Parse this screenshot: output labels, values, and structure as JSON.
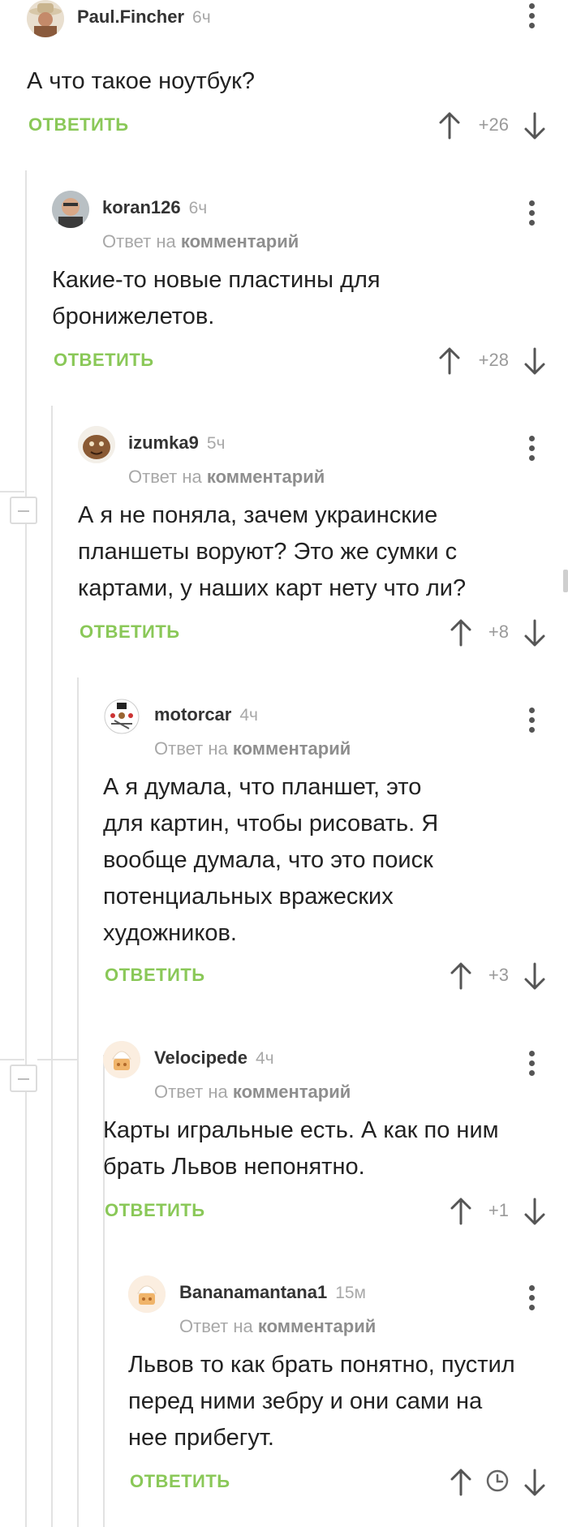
{
  "colors": {
    "accent": "#8ac858",
    "muted": "#a8a8a8",
    "text": "#222222"
  },
  "comments": [
    {
      "username": "Paul.Fincher",
      "time": "6ч",
      "reply_prefix": "",
      "reply_target": "",
      "text": "А что такое ноутбук?",
      "reply_label": "ОТВЕТИТЬ",
      "score": "+26"
    },
    {
      "username": "koran126",
      "time": "6ч",
      "reply_prefix": "Ответ на",
      "reply_target": "комментарий",
      "text": "Какие-то новые пластины для бронижелетов.",
      "reply_label": "ОТВЕТИТЬ",
      "score": "+28"
    },
    {
      "username": "izumka9",
      "time": "5ч",
      "reply_prefix": "Ответ на",
      "reply_target": "комментарий",
      "text": "А я не поняла, зачем украинские планшеты воруют? Это же сумки с картами, у наших карт нету что ли?",
      "reply_label": "ОТВЕТИТЬ",
      "score": "+8"
    },
    {
      "username": "motorcar",
      "time": "4ч",
      "reply_prefix": "Ответ на",
      "reply_target": "комментарий",
      "text": "А я думала, что планшет, это для картин, чтобы рисовать. Я вообще думала, что это поиск потенциальных вражеских художников.",
      "reply_label": "ОТВЕТИТЬ",
      "score": "+3"
    },
    {
      "username": "Velocipede",
      "time": "4ч",
      "reply_prefix": "Ответ на",
      "reply_target": "комментарий",
      "text": "Карты игральные есть. А как по ним брать Львов непонятно.",
      "reply_label": "ОТВЕТИТЬ",
      "score": "+1"
    },
    {
      "username": "Bananamantana1",
      "time": "15м",
      "reply_prefix": "Ответ на",
      "reply_target": "комментарий",
      "text": "Львов то как брать понятно, пустил перед ними зебру и они сами на нее прибегут.",
      "reply_label": "ОТВЕТИТЬ",
      "score": ""
    }
  ]
}
